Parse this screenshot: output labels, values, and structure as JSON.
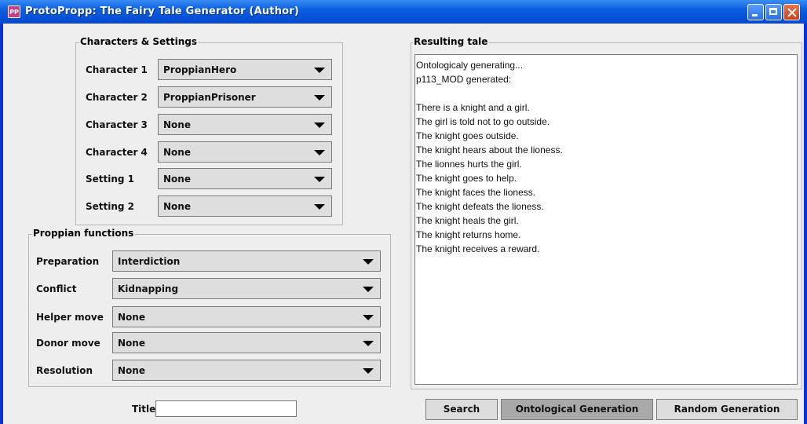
{
  "window": {
    "title": "ProtoPropp: The Fairy Tale Generator (Author)",
    "icon_text": "PP"
  },
  "characters": {
    "group_title": "Characters & Settings",
    "rows": [
      {
        "label": "Character 1",
        "value": "ProppianHero"
      },
      {
        "label": "Character 2",
        "value": "ProppianPrisoner"
      },
      {
        "label": "Character 3",
        "value": "None"
      },
      {
        "label": "Character 4",
        "value": "None"
      },
      {
        "label": "Setting 1",
        "value": "None"
      },
      {
        "label": "Setting 2",
        "value": "None"
      }
    ]
  },
  "functions": {
    "group_title": "Proppian functions",
    "rows": [
      {
        "label": "Preparation",
        "value": "Interdiction"
      },
      {
        "label": "Conflict",
        "value": "Kidnapping"
      },
      {
        "label": "Helper move",
        "value": "None"
      },
      {
        "label": "Donor move",
        "value": "None"
      },
      {
        "label": "Resolution",
        "value": "None"
      }
    ]
  },
  "title_field": {
    "label": "Title",
    "value": ""
  },
  "tale": {
    "group_title": "Resulting tale",
    "lines": [
      "Ontologicaly generating...",
      "p113_MOD generated:",
      "",
      "There is a knight and a girl.",
      "The girl is told not to go outside.",
      "The knight goes outside.",
      "The knight hears about the lioness.",
      "The lionnes hurts the girl.",
      "The knight goes to help.",
      "The knight faces the lioness.",
      "The knight defeats the lioness.",
      "The knight heals the girl.",
      "The knight returns home.",
      "The knight receives a reward."
    ]
  },
  "buttons": {
    "search": "Search",
    "ontological": "Ontological Generation",
    "random": "Random Generation"
  }
}
